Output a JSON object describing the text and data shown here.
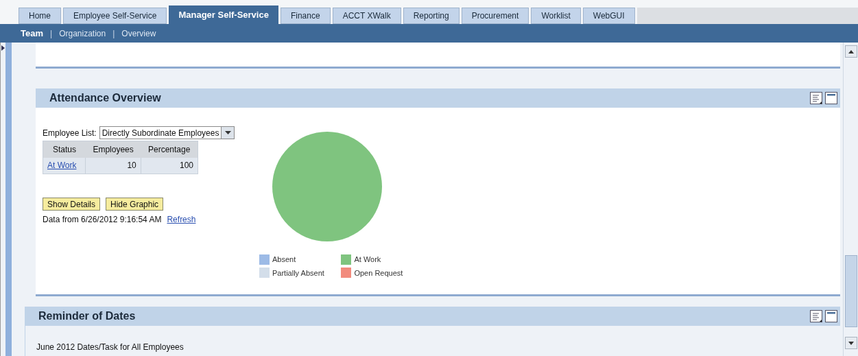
{
  "tabs": [
    {
      "label": "Home",
      "selected": false
    },
    {
      "label": "Employee Self-Service",
      "selected": false
    },
    {
      "label": "Manager Self-Service",
      "selected": true
    },
    {
      "label": "Finance",
      "selected": false
    },
    {
      "label": "ACCT XWalk",
      "selected": false
    },
    {
      "label": "Reporting",
      "selected": false
    },
    {
      "label": "Procurement",
      "selected": false
    },
    {
      "label": "Worklist",
      "selected": false
    },
    {
      "label": "WebGUI",
      "selected": false
    }
  ],
  "subnav": [
    {
      "label": "Team",
      "selected": true
    },
    {
      "label": "Organization",
      "selected": false
    },
    {
      "label": "Overview",
      "selected": false
    }
  ],
  "subnav_separator": "|",
  "attendance": {
    "title": "Attendance Overview",
    "employee_list": {
      "label": "Employee List:",
      "value": "Directly Subordinate Employees"
    },
    "table": {
      "columns": [
        "Status",
        "Employees",
        "Percentage"
      ],
      "rows": [
        [
          "At Work",
          "10",
          "100"
        ]
      ]
    },
    "buttons": [
      "Show Details",
      "Hide Graphic"
    ],
    "data_from": "Data from 6/26/2012 9:16:54 AM",
    "refresh": "Refresh",
    "chart_data": {
      "type": "pie",
      "categories": [
        "Absent",
        "At Work",
        "Partially Absent",
        "Open Request"
      ],
      "colors": [
        "#9dbbe6",
        "#7fc47f",
        "#d3deea",
        "#f28b7d"
      ],
      "series": [
        {
          "values": [
            0,
            100,
            0,
            0
          ]
        }
      ]
    }
  },
  "reminder": {
    "title": "Reminder of Dates",
    "text": "June 2012 Dates/Task for All Employees"
  }
}
